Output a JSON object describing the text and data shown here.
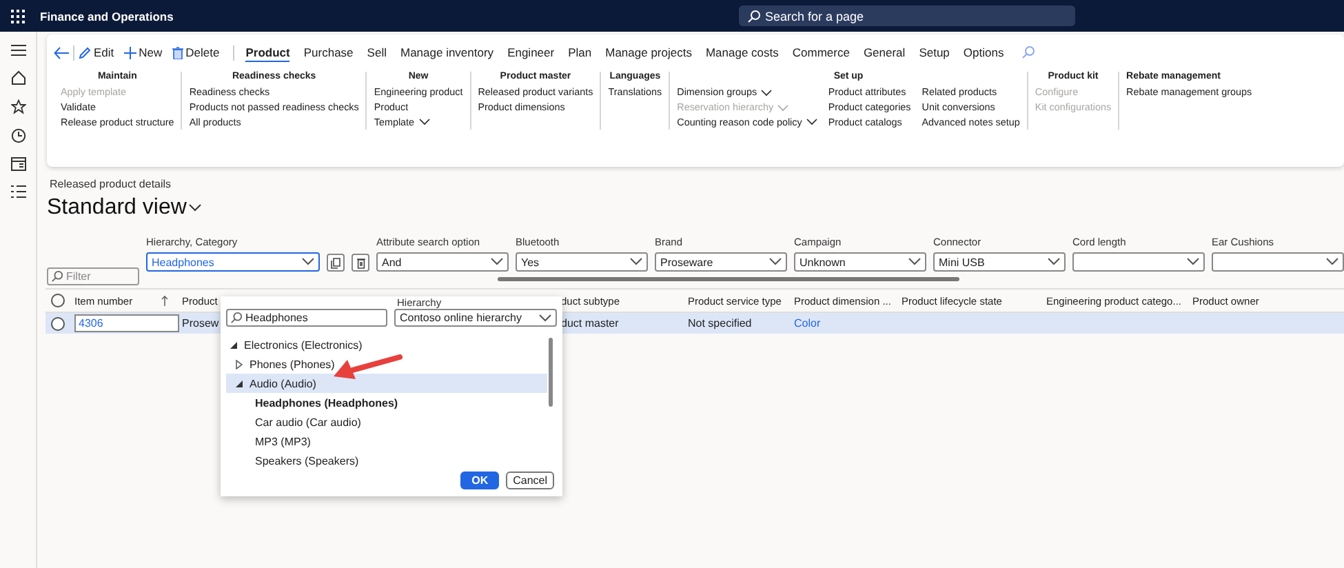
{
  "app_bar": {
    "title": "Finance and Operations",
    "search_placeholder": "Search for a page"
  },
  "action_pane": {
    "actions": [
      {
        "label": "Edit",
        "kind": "edit"
      },
      {
        "label": "New",
        "kind": "new"
      },
      {
        "label": "Delete",
        "kind": "delete"
      }
    ],
    "tabs": [
      {
        "label": "Product",
        "selected": true
      },
      {
        "label": "Purchase",
        "selected": false
      },
      {
        "label": "Sell",
        "selected": false
      },
      {
        "label": "Manage inventory",
        "selected": false
      },
      {
        "label": "Engineer",
        "selected": false
      },
      {
        "label": "Plan",
        "selected": false
      },
      {
        "label": "Manage projects",
        "selected": false
      },
      {
        "label": "Manage costs",
        "selected": false
      },
      {
        "label": "Commerce",
        "selected": false
      },
      {
        "label": "General",
        "selected": false
      },
      {
        "label": "Setup",
        "selected": false
      },
      {
        "label": "Options",
        "selected": false
      }
    ],
    "groups": [
      {
        "title": "Maintain",
        "columns": [
          [
            {
              "label": "Apply template",
              "disabled": true,
              "dropdown": false
            },
            {
              "label": "Validate",
              "disabled": false,
              "dropdown": false
            },
            {
              "label": "Release product structure",
              "disabled": false,
              "dropdown": false
            }
          ]
        ]
      },
      {
        "title": "Readiness checks",
        "columns": [
          [
            {
              "label": "Readiness checks",
              "disabled": false,
              "dropdown": false
            },
            {
              "label": "Products not passed readiness checks",
              "disabled": false,
              "dropdown": false
            },
            {
              "label": "All products",
              "disabled": false,
              "dropdown": false
            }
          ]
        ]
      },
      {
        "title": "New",
        "columns": [
          [
            {
              "label": "Engineering product",
              "disabled": false,
              "dropdown": false
            },
            {
              "label": "Product",
              "disabled": false,
              "dropdown": false
            },
            {
              "label": "Template",
              "disabled": false,
              "dropdown": true
            }
          ]
        ]
      },
      {
        "title": "Product master",
        "columns": [
          [
            {
              "label": "Released product variants",
              "disabled": false,
              "dropdown": false
            },
            {
              "label": "Product dimensions",
              "disabled": false,
              "dropdown": false
            }
          ]
        ]
      },
      {
        "title": "Languages",
        "columns": [
          [
            {
              "label": "Translations",
              "disabled": false,
              "dropdown": false
            }
          ]
        ]
      },
      {
        "title": "Set up",
        "columns": [
          [
            {
              "label": "Dimension groups",
              "disabled": false,
              "dropdown": true
            },
            {
              "label": "Reservation hierarchy",
              "disabled": true,
              "dropdown": true
            },
            {
              "label": "Counting reason code policy",
              "disabled": false,
              "dropdown": true
            }
          ],
          [
            {
              "label": "Product attributes",
              "disabled": false,
              "dropdown": false
            },
            {
              "label": "Product categories",
              "disabled": false,
              "dropdown": false
            },
            {
              "label": "Product catalogs",
              "disabled": false,
              "dropdown": false
            }
          ],
          [
            {
              "label": "Related products",
              "disabled": false,
              "dropdown": false
            },
            {
              "label": "Unit conversions",
              "disabled": false,
              "dropdown": false
            },
            {
              "label": "Advanced notes setup",
              "disabled": false,
              "dropdown": false
            }
          ]
        ]
      },
      {
        "title": "Product kit",
        "columns": [
          [
            {
              "label": "Configure",
              "disabled": true,
              "dropdown": false
            },
            {
              "label": "Kit configurations",
              "disabled": true,
              "dropdown": false
            }
          ]
        ]
      },
      {
        "title": "Rebate management",
        "columns": [
          [
            {
              "label": "Rebate management groups",
              "disabled": false,
              "dropdown": false
            }
          ]
        ]
      }
    ]
  },
  "page": {
    "breadcrumb": "Released product details",
    "view_title": "Standard view"
  },
  "filter": {
    "placeholder": "Filter"
  },
  "filter_fields": [
    {
      "label": "Hierarchy, Category",
      "value": "Headphones",
      "kind": "category",
      "focused": true
    },
    {
      "label": "Attribute search option",
      "value": "And",
      "kind": "select",
      "focused": false
    },
    {
      "label": "Bluetooth",
      "value": "Yes",
      "kind": "select",
      "focused": false
    },
    {
      "label": "Brand",
      "value": "Proseware",
      "kind": "select",
      "focused": false
    },
    {
      "label": "Campaign",
      "value": "Unknown",
      "kind": "select",
      "focused": false
    },
    {
      "label": "Connector",
      "value": "Mini USB",
      "kind": "select",
      "focused": false
    },
    {
      "label": "Cord length",
      "kind": "select",
      "focused": false
    },
    {
      "label": "Ear Cushions",
      "kind": "select",
      "focused": false
    }
  ],
  "grid": {
    "all_selected": false,
    "columns": [
      {
        "label": "Item number",
        "sorted": true
      },
      {
        "label": "Product",
        "sorted": false
      },
      {
        "label": "duct subtype",
        "sorted": false
      },
      {
        "label": "Product service type",
        "sorted": false
      },
      {
        "label": "Product dimension ...",
        "sorted": false
      },
      {
        "label": "Product lifecycle state",
        "sorted": false
      },
      {
        "label": "Engineering product catego...",
        "sorted": false
      },
      {
        "label": "Product owner",
        "sorted": false
      }
    ],
    "rows": [
      {
        "selected": true,
        "cells": [
          {
            "text": "4306",
            "kind": "editing"
          },
          {
            "text": "Prosew",
            "kind": "plain"
          },
          {
            "text": "duct master",
            "kind": "plain"
          },
          {
            "text": "Not specified",
            "kind": "plain"
          },
          {
            "text": "Color",
            "kind": "link"
          }
        ]
      }
    ]
  },
  "category_popup": {
    "hierarchy_label": "Hierarchy",
    "search_value": "Headphones",
    "hierarchy_value": "Contoso online hierarchy",
    "tree": [
      {
        "label": "Electronics (Electronics)",
        "expanded": true,
        "selected": false,
        "matched": false,
        "children": [
          {
            "label": "Phones (Phones)",
            "expanded": false,
            "selected": false,
            "matched": false
          },
          {
            "label": "Audio (Audio)",
            "expanded": true,
            "selected": true,
            "matched": false,
            "children": [
              {
                "label": "Headphones (Headphones)",
                "selected": false,
                "matched": true
              },
              {
                "label": "Car audio (Car audio)",
                "selected": false,
                "matched": false
              },
              {
                "label": "MP3 (MP3)",
                "selected": false,
                "matched": false
              },
              {
                "label": "Speakers (Speakers)",
                "selected": false,
                "matched": false
              }
            ]
          }
        ]
      }
    ],
    "buttons": [
      {
        "label": "OK",
        "kind": "primary"
      },
      {
        "label": "Cancel",
        "kind": "secondary"
      }
    ]
  }
}
